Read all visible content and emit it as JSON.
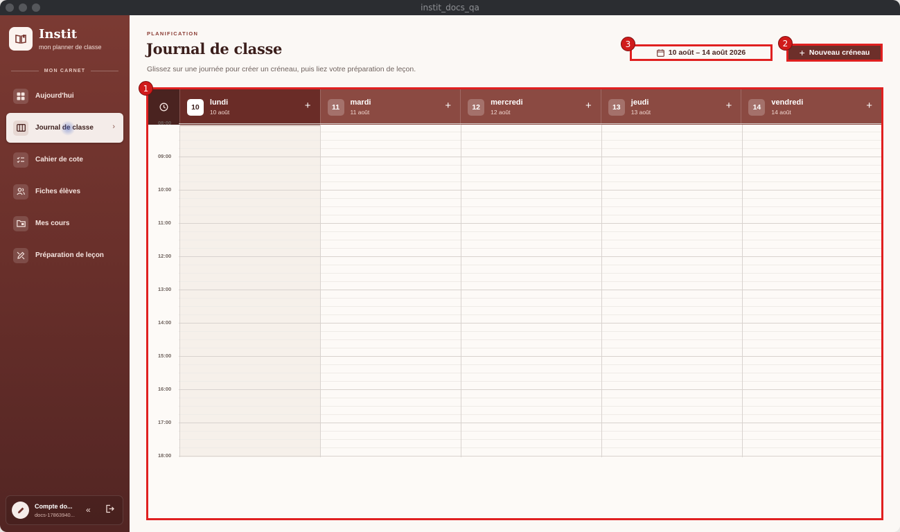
{
  "window": {
    "title": "instit_docs_qa"
  },
  "sidebar": {
    "brand": {
      "name": "Instit",
      "tagline": "mon planner de classe"
    },
    "section_label": "MON CARNET",
    "items": [
      {
        "label": "Aujourd'hui",
        "icon": "grid-icon"
      },
      {
        "label": "Journal de classe",
        "icon": "calendar-list-icon",
        "active": true
      },
      {
        "label": "Cahier de cote",
        "icon": "checklist-icon"
      },
      {
        "label": "Fiches élèves",
        "icon": "students-icon"
      },
      {
        "label": "Mes cours",
        "icon": "folder-icon"
      },
      {
        "label": "Préparation de leçon",
        "icon": "pencil-ruler-icon"
      }
    ],
    "account": {
      "name": "Compte do...",
      "id": "docs-17863940..."
    }
  },
  "header": {
    "eyebrow": "PLANIFICATION",
    "title": "Journal de classe",
    "subtitle": "Glissez sur une journée pour créer un créneau, puis liez votre préparation de leçon.",
    "date_range": "10 août – 14 août 2026",
    "new_slot_label": "Nouveau créneau"
  },
  "annotations": {
    "calendar": "1",
    "new_slot": "2",
    "date_range": "3"
  },
  "calendar": {
    "days": [
      {
        "num": "10",
        "name": "lundi",
        "date": "10 août",
        "today": true
      },
      {
        "num": "11",
        "name": "mardi",
        "date": "11 août"
      },
      {
        "num": "12",
        "name": "mercredi",
        "date": "12 août"
      },
      {
        "num": "13",
        "name": "jeudi",
        "date": "13 août"
      },
      {
        "num": "14",
        "name": "vendredi",
        "date": "14 août"
      }
    ],
    "hours": [
      "08:00",
      "09:00",
      "10:00",
      "11:00",
      "12:00",
      "13:00",
      "14:00",
      "15:00",
      "16:00",
      "17:00",
      "18:00"
    ],
    "add_symbol": "+"
  },
  "colors": {
    "accent": "#6d2f2a",
    "sidebar_top": "#7b3a33",
    "highlight": "#e02020"
  }
}
